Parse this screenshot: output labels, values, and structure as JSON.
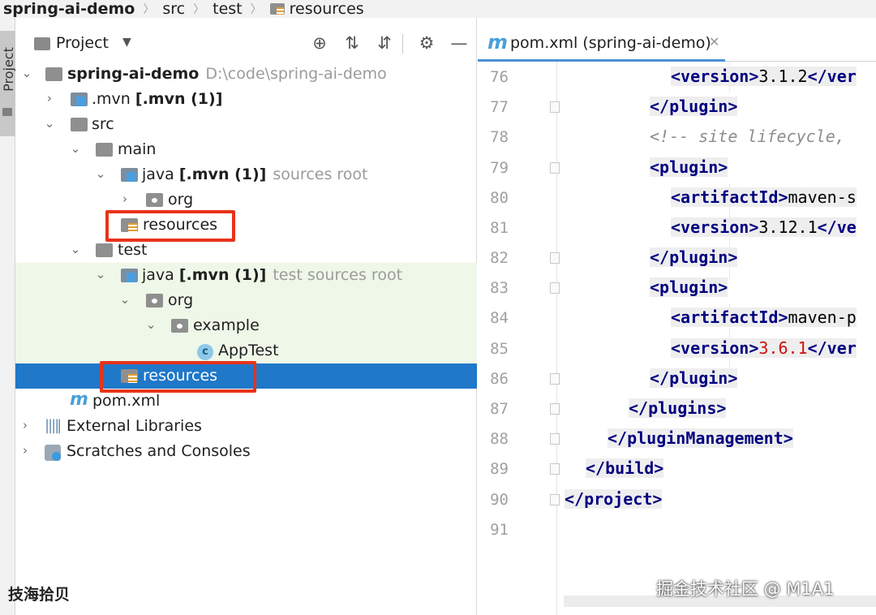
{
  "breadcrumb": [
    "spring-ai-demo",
    "src",
    "test",
    "resources"
  ],
  "tool_strip": {
    "label": "Project"
  },
  "panel": {
    "title": "Project",
    "icons": [
      "locate-icon",
      "expand-all-icon",
      "collapse-all-icon",
      "gear-icon",
      "minimize-icon"
    ]
  },
  "tree": [
    {
      "name": "spring-ai-demo",
      "hint": "D:\\code\\spring-ai-demo",
      "bold": true,
      "state": "expanded",
      "icon": "module-folder"
    },
    {
      "name": ".mvn",
      "suffix": "[.mvn (1)]",
      "state": "collapsed",
      "icon": "folder-mvn"
    },
    {
      "name": "src",
      "state": "expanded",
      "icon": "folder"
    },
    {
      "name": "main",
      "state": "expanded",
      "icon": "folder"
    },
    {
      "name": "java",
      "suffix": "[.mvn (1)]",
      "hint": "sources root",
      "state": "expanded",
      "icon": "source-root-folder"
    },
    {
      "name": "org",
      "state": "collapsed",
      "icon": "package-folder"
    },
    {
      "name": "resources",
      "icon": "resources-folder",
      "highlighted": true
    },
    {
      "name": "test",
      "state": "expanded",
      "icon": "folder"
    },
    {
      "name": "java",
      "suffix": "[.mvn (1)]",
      "hint": "test sources root",
      "state": "expanded",
      "icon": "test-source-root-folder"
    },
    {
      "name": "org",
      "state": "expanded",
      "icon": "package-folder"
    },
    {
      "name": "example",
      "state": "expanded",
      "icon": "package-folder"
    },
    {
      "name": "AppTest",
      "icon": "class"
    },
    {
      "name": "resources",
      "icon": "test-resources-folder",
      "selected": true,
      "highlighted": true
    },
    {
      "name": "pom.xml",
      "icon": "maven-file"
    },
    {
      "name": "External Libraries",
      "state": "collapsed",
      "icon": "libraries"
    },
    {
      "name": "Scratches and Consoles",
      "state": "collapsed",
      "icon": "scratches"
    }
  ],
  "editor": {
    "tab_title": "pom.xml (spring-ai-demo)",
    "lines": [
      {
        "n": "76",
        "text": "<version>3.1.2</ver"
      },
      {
        "n": "77",
        "text": "</plugin>"
      },
      {
        "n": "78",
        "text": "<!-- site lifecycle,"
      },
      {
        "n": "79",
        "text": "<plugin>"
      },
      {
        "n": "80",
        "text": "<artifactId>maven-s"
      },
      {
        "n": "81",
        "text": "<version>3.12.1</ve"
      },
      {
        "n": "82",
        "text": "</plugin>"
      },
      {
        "n": "83",
        "text": "<plugin>"
      },
      {
        "n": "84",
        "text": "<artifactId>maven-p"
      },
      {
        "n": "85",
        "text": "<version>3.6.1</ver"
      },
      {
        "n": "86",
        "text": "</plugin>"
      },
      {
        "n": "87",
        "text": "</plugins>"
      },
      {
        "n": "88",
        "text": "</pluginManagement>"
      },
      {
        "n": "89",
        "text": "</build>"
      },
      {
        "n": "90",
        "text": "</project>"
      },
      {
        "n": "91",
        "text": ""
      }
    ]
  },
  "watermarks": {
    "left": "技海拾贝",
    "right": "掘金技术社区 @ M1A1"
  },
  "colors": {
    "selection": "#1f78c8",
    "highlight_box": "#e8331a",
    "test_bg": "#eef7e8",
    "xml_tag": "#000080"
  }
}
